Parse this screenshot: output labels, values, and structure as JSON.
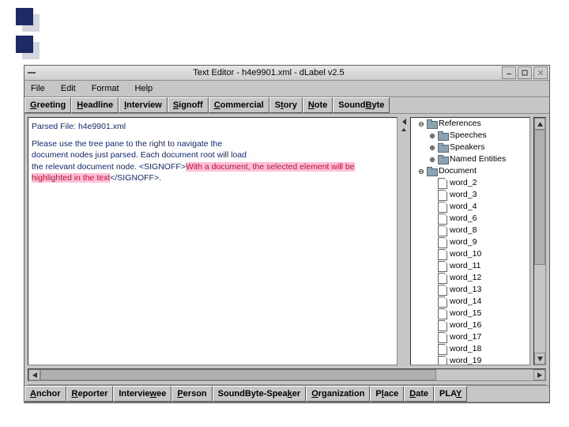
{
  "window": {
    "title": "Text Editor - h4e9901.xml - dLabel v2.5"
  },
  "menubar": [
    "File",
    "Edit",
    "Format",
    "Help"
  ],
  "toolbar_top": [
    {
      "pre": "",
      "ul": "G",
      "post": "reeting"
    },
    {
      "pre": "",
      "ul": "H",
      "post": "eadline"
    },
    {
      "pre": "",
      "ul": "I",
      "post": "nterview"
    },
    {
      "pre": "",
      "ul": "S",
      "post": "ignoff"
    },
    {
      "pre": "",
      "ul": "C",
      "post": "ommercial"
    },
    {
      "pre": "S",
      "ul": "t",
      "post": "ory"
    },
    {
      "pre": "",
      "ul": "N",
      "post": "ote"
    },
    {
      "pre": "Sound",
      "ul": "B",
      "post": "yte"
    }
  ],
  "toolbar_bottom": [
    {
      "pre": "",
      "ul": "A",
      "post": "nchor"
    },
    {
      "pre": "",
      "ul": "R",
      "post": "eporter"
    },
    {
      "pre": "Intervie",
      "ul": "w",
      "post": "ee"
    },
    {
      "pre": "",
      "ul": "P",
      "post": "erson"
    },
    {
      "pre": "SoundByte-Spea",
      "ul": "k",
      "post": "er"
    },
    {
      "pre": "",
      "ul": "O",
      "post": "rganization"
    },
    {
      "pre": "P",
      "ul": "l",
      "post": "ace"
    },
    {
      "pre": "",
      "ul": "D",
      "post": "ate"
    },
    {
      "pre": "PLA",
      "ul": "Y",
      "post": ""
    }
  ],
  "textpane": {
    "line1": "Parsed File: h4e9901.xml",
    "line2": "Please use the tree pane to the right to navigate the",
    "line3": "document nodes just parsed.  Each document root will load",
    "line4a": "the relevant document node.   <SIGNOFF>",
    "hl": "With a document, the selected element will be highlighted in the text",
    "line5b": "</SIGNOFF>."
  },
  "tree": [
    {
      "indent": 0,
      "handle": "open",
      "icon": "folder",
      "label": "References"
    },
    {
      "indent": 1,
      "handle": "closed",
      "icon": "folder",
      "label": "Speeches"
    },
    {
      "indent": 1,
      "handle": "closed",
      "icon": "folder",
      "label": "Speakers"
    },
    {
      "indent": 1,
      "handle": "closed",
      "icon": "folder",
      "label": "Named Entities"
    },
    {
      "indent": 0,
      "handle": "open",
      "icon": "folder",
      "label": "Document"
    },
    {
      "indent": 1,
      "handle": "",
      "icon": "doc",
      "label": "word_2"
    },
    {
      "indent": 1,
      "handle": "",
      "icon": "doc",
      "label": "word_3"
    },
    {
      "indent": 1,
      "handle": "",
      "icon": "doc",
      "label": "word_4"
    },
    {
      "indent": 1,
      "handle": "",
      "icon": "doc",
      "label": "word_6"
    },
    {
      "indent": 1,
      "handle": "",
      "icon": "doc",
      "label": "word_8"
    },
    {
      "indent": 1,
      "handle": "",
      "icon": "doc",
      "label": "word_9"
    },
    {
      "indent": 1,
      "handle": "",
      "icon": "doc",
      "label": "word_10"
    },
    {
      "indent": 1,
      "handle": "",
      "icon": "doc",
      "label": "word_11"
    },
    {
      "indent": 1,
      "handle": "",
      "icon": "doc",
      "label": "word_12"
    },
    {
      "indent": 1,
      "handle": "",
      "icon": "doc",
      "label": "word_13"
    },
    {
      "indent": 1,
      "handle": "",
      "icon": "doc",
      "label": "word_14"
    },
    {
      "indent": 1,
      "handle": "",
      "icon": "doc",
      "label": "word_15"
    },
    {
      "indent": 1,
      "handle": "",
      "icon": "doc",
      "label": "word_16"
    },
    {
      "indent": 1,
      "handle": "",
      "icon": "doc",
      "label": "word_17"
    },
    {
      "indent": 1,
      "handle": "",
      "icon": "doc",
      "label": "word_18"
    },
    {
      "indent": 1,
      "handle": "",
      "icon": "doc",
      "label": "word_19"
    }
  ]
}
